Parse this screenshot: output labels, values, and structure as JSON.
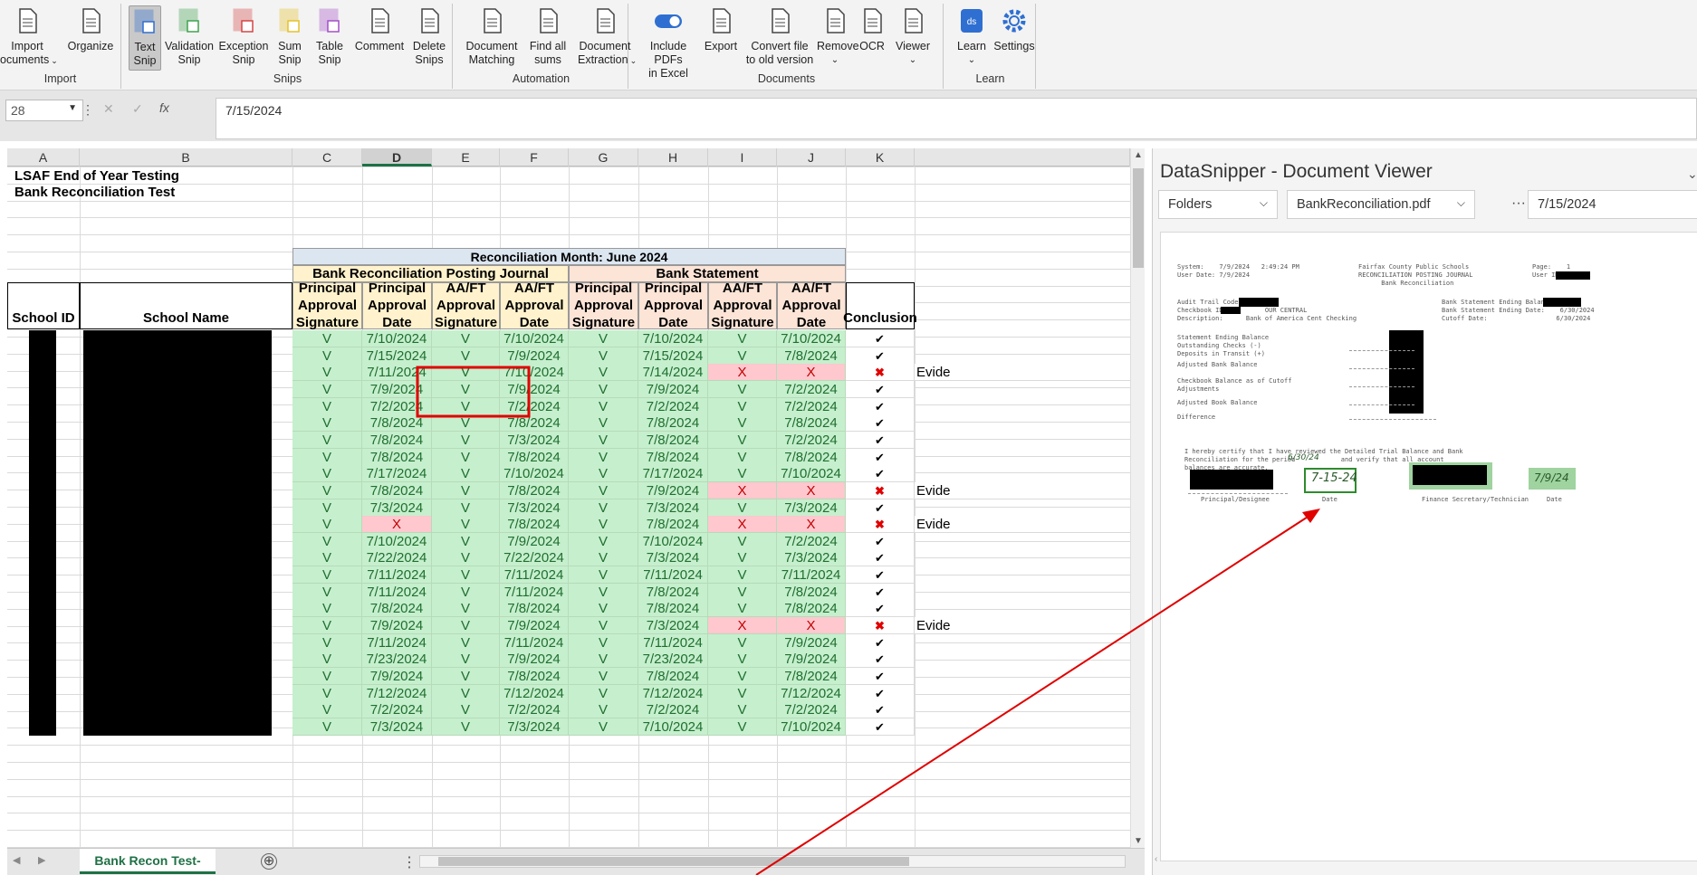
{
  "ribbon": {
    "groups": [
      {
        "label": "Import",
        "buttons": [
          {
            "label": "Import",
            "label2": "ocuments",
            "arrow": true,
            "name": "import-documents-button",
            "icon": "import-icon"
          },
          {
            "label": "Organize",
            "label2": "",
            "name": "organize-button",
            "icon": "organize-icon"
          }
        ]
      },
      {
        "label": "Snips",
        "buttons": [
          {
            "label": "Text",
            "label2": "Snip",
            "name": "text-snip-button",
            "icon": "text-snip-icon",
            "active": true
          },
          {
            "label": "Validation",
            "label2": "Snip",
            "name": "validation-snip-button",
            "icon": "validation-snip-icon"
          },
          {
            "label": "Exception",
            "label2": "Snip",
            "name": "exception-snip-button",
            "icon": "exception-snip-icon"
          },
          {
            "label": "Sum",
            "label2": "Snip",
            "name": "sum-snip-button",
            "icon": "sum-snip-icon"
          },
          {
            "label": "Table",
            "label2": "Snip",
            "name": "table-snip-button",
            "icon": "table-snip-icon"
          },
          {
            "label": "Comment",
            "label2": "",
            "name": "comment-button",
            "icon": "comment-icon"
          },
          {
            "label": "Delete",
            "label2": "Snips",
            "name": "delete-snips-button",
            "icon": "delete-snips-icon"
          }
        ]
      },
      {
        "label": "Automation",
        "buttons": [
          {
            "label": "Document",
            "label2": "Matching",
            "name": "document-matching-button",
            "icon": "document-matching-icon"
          },
          {
            "label": "Find all",
            "label2": "sums",
            "name": "find-all-sums-button",
            "icon": "sum-icon"
          },
          {
            "label": "Document",
            "label2": "Extraction",
            "arrow": true,
            "name": "document-extraction-button",
            "icon": "document-extraction-icon"
          }
        ]
      },
      {
        "label": "Documents",
        "buttons": [
          {
            "label": "Include PDFs",
            "label2": "in Excel",
            "name": "include-pdfs-toggle",
            "icon": "toggle-icon"
          },
          {
            "label": "Export",
            "label2": "",
            "name": "export-button",
            "icon": "export-icon"
          },
          {
            "label": "Convert file",
            "label2": "to old version",
            "name": "convert-file-button",
            "icon": "convert-icon"
          },
          {
            "label": "Remove",
            "label2": "",
            "arrow": true,
            "name": "remove-button",
            "icon": "remove-icon"
          },
          {
            "label": "OCR",
            "label2": "",
            "name": "ocr-button",
            "icon": "ocr-icon"
          },
          {
            "label": "Viewer",
            "label2": "",
            "arrow": true,
            "name": "viewer-button",
            "icon": "viewer-icon"
          }
        ]
      },
      {
        "label": "Learn",
        "buttons": [
          {
            "label": "Learn",
            "label2": "",
            "arrow": true,
            "name": "learn-button",
            "icon": "ds-logo-icon"
          },
          {
            "label": "Settings",
            "label2": "",
            "name": "settings-button",
            "icon": "gear-icon"
          }
        ]
      }
    ]
  },
  "formula": {
    "namebox": "28",
    "value": "7/15/2024"
  },
  "columns": [
    "A",
    "B",
    "C",
    "D",
    "E",
    "F",
    "G",
    "H",
    "I",
    "J",
    "K"
  ],
  "sheet": {
    "title1": "LSAF End of Year Testing",
    "title2": "Bank Reconciliation Test",
    "recon_month": "Reconciliation Month: June 2024",
    "journal_header": "Bank Reconciliation Posting Journal",
    "statement_header": "Bank Statement",
    "school_id": "School ID",
    "school_name": "School Name",
    "conclusion": "Conclusion",
    "subheaders": [
      [
        "Principal",
        "Approval",
        "Signature"
      ],
      [
        "Principal",
        "Approval",
        "Date"
      ],
      [
        "AA/FT",
        "Approval",
        "Signature"
      ],
      [
        "AA/FT",
        "Approval",
        "Date"
      ],
      [
        "Principal",
        "Approval",
        "Signature"
      ],
      [
        "Principal",
        "Approval",
        "Date"
      ],
      [
        "AA/FT",
        "Approval",
        "Signature"
      ],
      [
        "AA/FT",
        "Approval",
        "Date"
      ]
    ],
    "rows": [
      [
        "V",
        "7/10/2024",
        "V",
        "7/10/2024",
        "V",
        "7/10/2024",
        "V",
        "7/10/2024",
        "ok",
        ""
      ],
      [
        "V",
        "7/15/2024",
        "V",
        "7/9/2024",
        "V",
        "7/15/2024",
        "V",
        "7/8/2024",
        "ok",
        ""
      ],
      [
        "V",
        "7/11/2024",
        "V",
        "7/10/2024",
        "V",
        "7/14/2024",
        "X",
        "X",
        "x",
        "Evide"
      ],
      [
        "V",
        "7/9/2024",
        "V",
        "7/9/2024",
        "V",
        "7/9/2024",
        "V",
        "7/2/2024",
        "ok",
        ""
      ],
      [
        "V",
        "7/2/2024",
        "V",
        "7/2/2024",
        "V",
        "7/2/2024",
        "V",
        "7/2/2024",
        "ok",
        ""
      ],
      [
        "V",
        "7/8/2024",
        "V",
        "7/8/2024",
        "V",
        "7/8/2024",
        "V",
        "7/8/2024",
        "ok",
        ""
      ],
      [
        "V",
        "7/8/2024",
        "V",
        "7/3/2024",
        "V",
        "7/8/2024",
        "V",
        "7/2/2024",
        "ok",
        ""
      ],
      [
        "V",
        "7/8/2024",
        "V",
        "7/8/2024",
        "V",
        "7/8/2024",
        "V",
        "7/8/2024",
        "ok",
        ""
      ],
      [
        "V",
        "7/17/2024",
        "V",
        "7/10/2024",
        "V",
        "7/17/2024",
        "V",
        "7/10/2024",
        "ok",
        ""
      ],
      [
        "V",
        "7/8/2024",
        "V",
        "7/8/2024",
        "V",
        "7/9/2024",
        "X",
        "X",
        "x",
        "Evide"
      ],
      [
        "V",
        "7/3/2024",
        "V",
        "7/3/2024",
        "V",
        "7/3/2024",
        "V",
        "7/3/2024",
        "ok",
        ""
      ],
      [
        "V",
        "X",
        "V",
        "7/8/2024",
        "V",
        "7/8/2024",
        "X",
        "X",
        "x",
        "Evide"
      ],
      [
        "V",
        "7/10/2024",
        "V",
        "7/9/2024",
        "V",
        "7/10/2024",
        "V",
        "7/2/2024",
        "ok",
        ""
      ],
      [
        "V",
        "7/22/2024",
        "V",
        "7/22/2024",
        "V",
        "7/3/2024",
        "V",
        "7/3/2024",
        "ok",
        ""
      ],
      [
        "V",
        "7/11/2024",
        "V",
        "7/11/2024",
        "V",
        "7/11/2024",
        "V",
        "7/11/2024",
        "ok",
        ""
      ],
      [
        "V",
        "7/11/2024",
        "V",
        "7/11/2024",
        "V",
        "7/8/2024",
        "V",
        "7/8/2024",
        "ok",
        ""
      ],
      [
        "V",
        "7/8/2024",
        "V",
        "7/8/2024",
        "V",
        "7/8/2024",
        "V",
        "7/8/2024",
        "ok",
        ""
      ],
      [
        "V",
        "7/9/2024",
        "V",
        "7/9/2024",
        "V",
        "7/3/2024",
        "X",
        "X",
        "x",
        "Evide"
      ],
      [
        "V",
        "7/11/2024",
        "V",
        "7/11/2024",
        "V",
        "7/11/2024",
        "V",
        "7/9/2024",
        "ok",
        ""
      ],
      [
        "V",
        "7/23/2024",
        "V",
        "7/9/2024",
        "V",
        "7/23/2024",
        "V",
        "7/9/2024",
        "ok",
        ""
      ],
      [
        "V",
        "7/9/2024",
        "V",
        "7/8/2024",
        "V",
        "7/8/2024",
        "V",
        "7/8/2024",
        "ok",
        ""
      ],
      [
        "V",
        "7/12/2024",
        "V",
        "7/12/2024",
        "V",
        "7/12/2024",
        "V",
        "7/12/2024",
        "ok",
        ""
      ],
      [
        "V",
        "7/2/2024",
        "V",
        "7/2/2024",
        "V",
        "7/2/2024",
        "V",
        "7/2/2024",
        "ok",
        ""
      ],
      [
        "V",
        "7/3/2024",
        "V",
        "7/3/2024",
        "V",
        "7/10/2024",
        "V",
        "7/10/2024",
        "ok",
        ""
      ]
    ]
  },
  "tabs": {
    "active": "Bank Recon Test-LSAF",
    "add": "⊕"
  },
  "panel": {
    "title": "DataSnipper - Document Viewer",
    "folders": "Folders",
    "file": "BankReconciliation.pdf",
    "more": "···",
    "search": "7/15/2024",
    "doc": {
      "left_header": "System:    7/9/2024   2:49:24 PM\nUser Date: 7/9/2024",
      "center_header": "Fairfax County Public Schools\nRECONCILIATION POSTING JOURNAL\n      Bank Reconciliation",
      "right_header": "Page:    1\nUser ID:",
      "audit": "Audit Trail Code:\nCheckbook ID:          OUR CENTRAL\nDescription:      Bank of America Cent Checking",
      "right_block": "Bank Statement Ending Balance:\nBank Statement Ending Date:    6/30/2024\nCutoff Date:                  6/30/2024",
      "balances": "Statement Ending Balance\nOutstanding Checks (-)\nDeposits in Transit (+)",
      "adjusted_bank": "Adjusted Bank Balance",
      "checkbook": "Checkbook Balance as of Cutoff\nAdjustments",
      "adjusted_book": "Adjusted Book Balance",
      "difference": "Difference",
      "certify": "I hereby certify that I have reviewed the Detailed Trial Balance and Bank\nReconciliation for the period            and verify that all account\nbalances are accurate.",
      "period_hand": "6/30/24",
      "principal_label": "Principal/Designee",
      "date_label": "Date",
      "fin_label": "Finance Secretary/Technician",
      "date_label2": "Date",
      "sig_date": "7-15-24",
      "sig_date2": "7/9/24"
    }
  }
}
